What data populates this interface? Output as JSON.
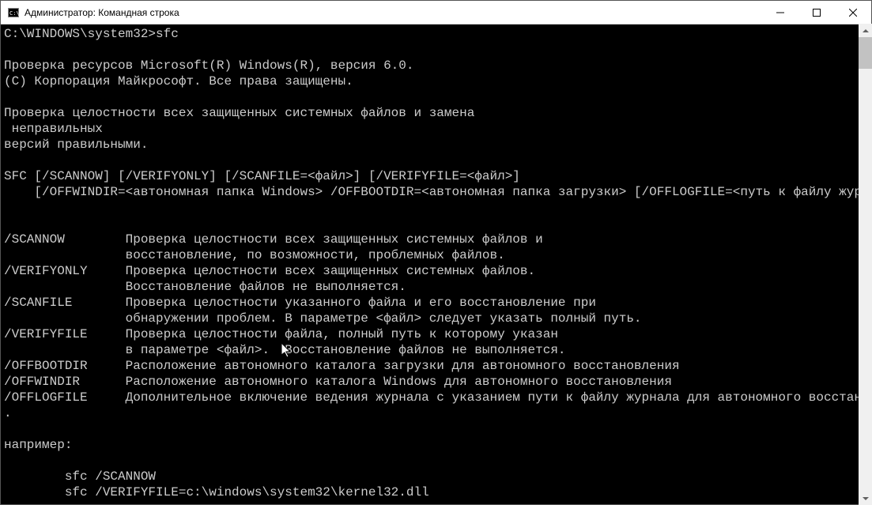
{
  "titlebar": {
    "icon_text": "C:\\",
    "title": "Администратор: Командная строка"
  },
  "console": {
    "prompt_path": "C:\\WINDOWS\\system32>",
    "command": "sfc",
    "header_line1": "Проверка ресурсов Microsoft(R) Windows(R), версия 6.0.",
    "header_line2": "(C) Корпорация Майкрософт. Все права защищены.",
    "desc_line1": "Проверка целостности всех защищенных системных файлов и замена",
    "desc_line2": " неправильных",
    "desc_line3": "версий правильными.",
    "syntax_line1": "SFC [/SCANNOW] [/VERIFYONLY] [/SCANFILE=<файл>] [/VERIFYFILE=<файл>]",
    "syntax_line2": "    [/OFFWINDIR=<автономная папка Windows> /OFFBOOTDIR=<автономная папка загрузки> [/OFFLOGFILE=<путь к файлу журнала>]]",
    "opt1": "/SCANNOW        Проверка целостности всех защищенных системных файлов и",
    "opt1b": "                восстановление, по возможности, проблемных файлов.",
    "opt2": "/VERIFYONLY     Проверка целостности всех защищенных системных файлов.",
    "opt2b": "                Восстановление файлов не выполняется.",
    "opt3": "/SCANFILE       Проверка целостности указанного файла и его восстановление при",
    "opt3b": "                обнаружении проблем. В параметре <файл> следует указать полный путь.",
    "opt4": "/VERIFYFILE     Проверка целостности файла, полный путь к которому указан",
    "opt4b": "                в параметре <файл>.  Восстановление файлов не выполняется.",
    "opt5": "/OFFBOOTDIR     Расположение автономного каталога загрузки для автономного восстановления",
    "opt6": "/OFFWINDIR      Расположение автономного каталога Windows для автономного восстановления",
    "opt7": "/OFFLOGFILE     Дополнительное включение ведения журнала с указанием пути к файлу журнала для автономного восстановления",
    "dot": ".",
    "example_label": "например:",
    "example1": "        sfc /SCANNOW",
    "example2": "        sfc /VERIFYFILE=c:\\windows\\system32\\kernel32.dll"
  }
}
